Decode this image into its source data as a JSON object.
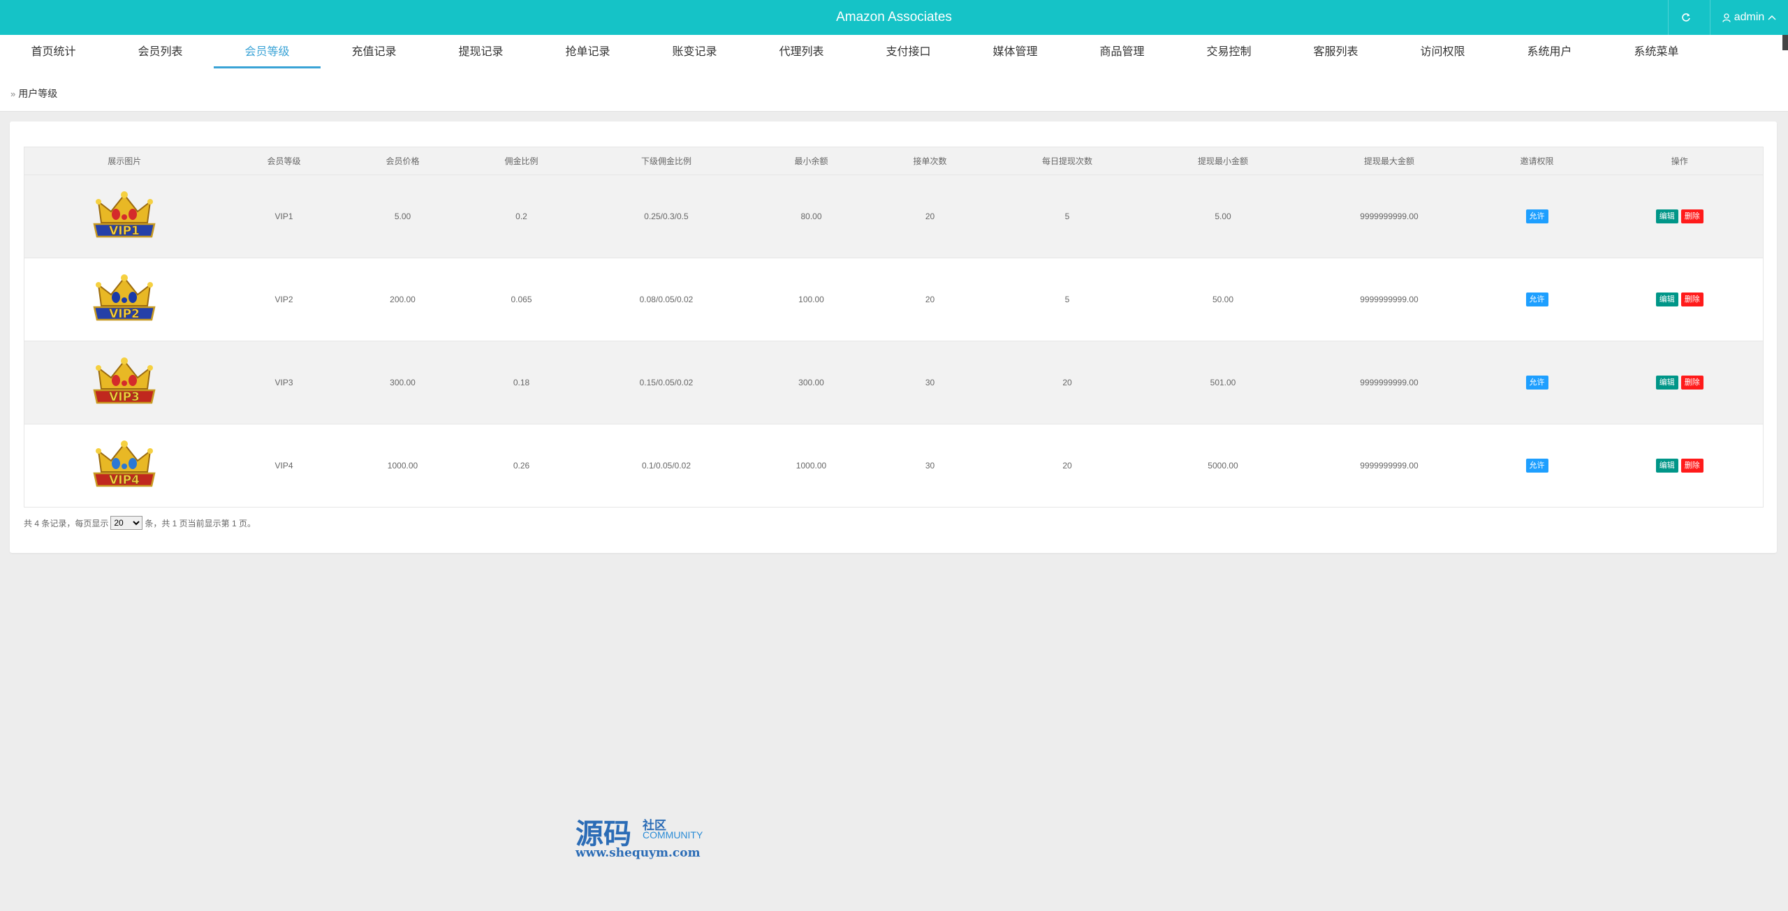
{
  "header": {
    "title": "Amazon Associates",
    "user": "admin",
    "bg_color": "#15c3c7"
  },
  "nav": {
    "items": [
      {
        "label": "首页统计"
      },
      {
        "label": "会员列表"
      },
      {
        "label": "会员等级",
        "active": true
      },
      {
        "label": "充值记录"
      },
      {
        "label": "提现记录"
      },
      {
        "label": "抢单记录"
      },
      {
        "label": "账变记录"
      },
      {
        "label": "代理列表"
      },
      {
        "label": "支付接口"
      },
      {
        "label": "媒体管理"
      },
      {
        "label": "商品管理"
      },
      {
        "label": "交易控制"
      },
      {
        "label": "客服列表"
      },
      {
        "label": "访问权限"
      },
      {
        "label": "系统用户"
      },
      {
        "label": "系统菜单"
      }
    ],
    "active_color": "#3aa3d6"
  },
  "breadcrumb": {
    "separator": "»",
    "label": "用户等级"
  },
  "table": {
    "columns": [
      "展示图片",
      "会员等级",
      "会员价格",
      "佣金比例",
      "下级佣金比例",
      "最小余额",
      "接单次数",
      "每日提现次数",
      "提现最小金额",
      "提现最大金额",
      "邀请权限",
      "操作"
    ],
    "rows": [
      {
        "image": "VIP1",
        "level": "VIP1",
        "price": "5.00",
        "commission": "0.2",
        "sub_commission": "0.25/0.3/0.5",
        "min_balance": "80.00",
        "orders": "20",
        "daily_withdraw": "5",
        "withdraw_min": "5.00",
        "withdraw_max": "9999999999.00",
        "invite": "允许",
        "edit": "编辑",
        "delete": "删除"
      },
      {
        "image": "VIP2",
        "level": "VIP2",
        "price": "200.00",
        "commission": "0.065",
        "sub_commission": "0.08/0.05/0.02",
        "min_balance": "100.00",
        "orders": "20",
        "daily_withdraw": "5",
        "withdraw_min": "50.00",
        "withdraw_max": "9999999999.00",
        "invite": "允许",
        "edit": "编辑",
        "delete": "删除"
      },
      {
        "image": "VIP3",
        "level": "VIP3",
        "price": "300.00",
        "commission": "0.18",
        "sub_commission": "0.15/0.05/0.02",
        "min_balance": "300.00",
        "orders": "30",
        "daily_withdraw": "20",
        "withdraw_min": "501.00",
        "withdraw_max": "9999999999.00",
        "invite": "允许",
        "edit": "编辑",
        "delete": "删除"
      },
      {
        "image": "VIP4",
        "level": "VIP4",
        "price": "1000.00",
        "commission": "0.26",
        "sub_commission": "0.1/0.05/0.02",
        "min_balance": "1000.00",
        "orders": "30",
        "daily_withdraw": "20",
        "withdraw_min": "5000.00",
        "withdraw_max": "9999999999.00",
        "invite": "允许",
        "edit": "编辑",
        "delete": "删除"
      }
    ]
  },
  "pagination": {
    "prefix": "共 4 条记录，每页显示",
    "page_size": "20",
    "options": [
      "20"
    ],
    "suffix": "条，共 1 页当前显示第 1 页。"
  },
  "watermark": {
    "big": "源码",
    "small1": "社区",
    "small2": "COMMUNITY",
    "url": "www.shequym.com"
  },
  "icons": {
    "refresh": "refresh-icon",
    "user": "user-icon",
    "chevron": "chevron-up-icon"
  }
}
